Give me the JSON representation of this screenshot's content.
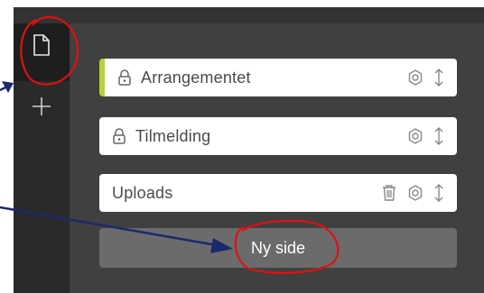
{
  "sidebar": {
    "items": [
      {
        "icon": "page-icon",
        "active": true
      },
      {
        "icon": "plus-icon",
        "active": false
      }
    ]
  },
  "pages": [
    {
      "label": "Arrangementet",
      "locked": true,
      "active": true,
      "actions": [
        "gear-icon",
        "reorder-icon"
      ]
    },
    {
      "label": "Tilmelding",
      "locked": true,
      "active": false,
      "actions": [
        "gear-icon",
        "reorder-icon"
      ]
    },
    {
      "label": "Uploads",
      "locked": false,
      "active": false,
      "actions": [
        "trash-icon",
        "gear-icon",
        "reorder-icon"
      ]
    }
  ],
  "new_page_button": {
    "label": "Ny side"
  },
  "colors": {
    "accent": "#b5d334",
    "panel": "#404040",
    "rail": "#2a2a2a",
    "annotation_circle": "#e01010",
    "annotation_arrow": "#1a2a6c"
  }
}
